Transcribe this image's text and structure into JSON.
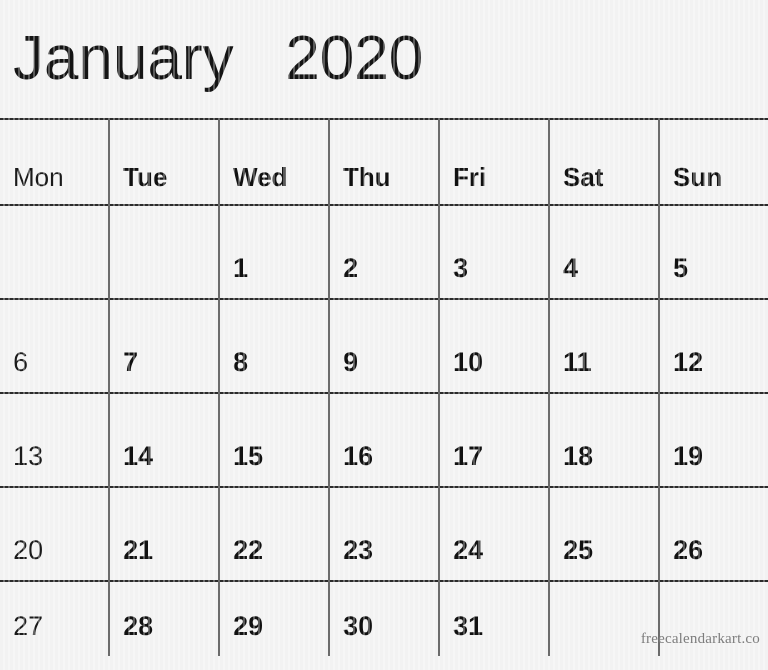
{
  "calendar": {
    "title": "January   2020",
    "month": "January",
    "year": "2020",
    "weekday_headers": [
      {
        "label": "Mon",
        "dim": true
      },
      {
        "label": "Tue",
        "dim": false
      },
      {
        "label": "Wed",
        "dim": false
      },
      {
        "label": "Thu",
        "dim": false
      },
      {
        "label": "Fri",
        "dim": false
      },
      {
        "label": "Sat",
        "dim": false
      },
      {
        "label": "Sun",
        "dim": false
      }
    ],
    "weeks": [
      {
        "days": [
          "",
          "",
          "1",
          "2",
          "3",
          "4",
          "5"
        ]
      },
      {
        "days": [
          "6",
          "7",
          "8",
          "9",
          "10",
          "11",
          "12"
        ]
      },
      {
        "days": [
          "13",
          "14",
          "15",
          "16",
          "17",
          "18",
          "19"
        ]
      },
      {
        "days": [
          "20",
          "21",
          "22",
          "23",
          "24",
          "25",
          "26"
        ]
      },
      {
        "days": [
          "27",
          "28",
          "29",
          "30",
          "31",
          "",
          ""
        ]
      }
    ],
    "watermark": "freecalendarkart.co",
    "colors": {
      "background": "#f2f2f2",
      "grid_line": "#2b2b2b",
      "text": "#111111",
      "watermark_text": "#7d7d7d"
    }
  }
}
